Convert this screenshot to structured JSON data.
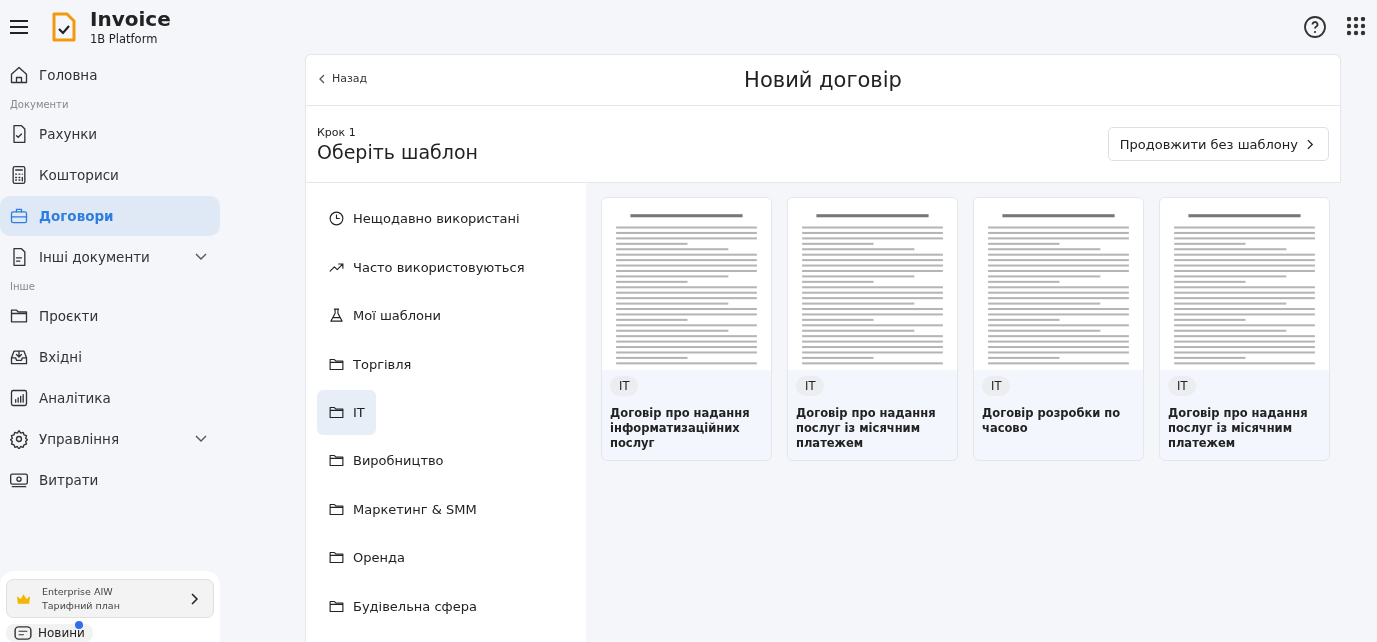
{
  "app": {
    "title": "Invoice",
    "subtitle": "1B Platform"
  },
  "sidebar": {
    "items": [
      {
        "kind": "link",
        "label": "Головна",
        "selected": false
      },
      {
        "kind": "section",
        "label": "Документи"
      },
      {
        "kind": "link",
        "label": "Рахунки",
        "selected": false
      },
      {
        "kind": "link",
        "label": "Кошториси",
        "selected": false
      },
      {
        "kind": "link",
        "label": "Договори",
        "selected": true
      },
      {
        "kind": "group",
        "label": "Інші документи",
        "selected": false,
        "expanded": false
      },
      {
        "kind": "section",
        "label": "Інше"
      },
      {
        "kind": "link",
        "label": "Проєкти",
        "selected": false
      },
      {
        "kind": "link",
        "label": "Вхідні",
        "selected": false
      },
      {
        "kind": "link",
        "label": "Аналітика",
        "selected": false
      },
      {
        "kind": "group",
        "label": "Управління",
        "selected": false,
        "expanded": false
      },
      {
        "kind": "link",
        "label": "Витрати",
        "selected": false
      }
    ],
    "plan": {
      "name": "Enterprise AIW",
      "label": "Тарифний план"
    },
    "news": {
      "label": "Новини",
      "unread": true
    }
  },
  "page": {
    "back": "Назад",
    "title": "Новий договір",
    "step": "Крок 1",
    "heading": "Оберіть шаблон",
    "skip_button": "Продовжити без шаблону"
  },
  "categories": [
    {
      "label": "Нещодавно використані",
      "selected": false
    },
    {
      "label": "Часто використовуються",
      "selected": false
    },
    {
      "label": "Мої шаблони",
      "selected": false
    },
    {
      "label": "Торгівля",
      "selected": false
    },
    {
      "label": "IT",
      "selected": true
    },
    {
      "label": "Виробництво",
      "selected": false
    },
    {
      "label": "Маркетинг & SMM",
      "selected": false
    },
    {
      "label": "Оренда",
      "selected": false
    },
    {
      "label": "Будівельна сфера",
      "selected": false
    }
  ],
  "templates": [
    {
      "tag": "IT",
      "title": "Договір про надання інформатизаційних послуг"
    },
    {
      "tag": "IT",
      "title": "Договір про надання послуг із місячним платежем"
    },
    {
      "tag": "IT",
      "title": "Договір розробки по часово"
    },
    {
      "tag": "IT",
      "title": "Договір про надання послуг із місячним платежем"
    }
  ]
}
